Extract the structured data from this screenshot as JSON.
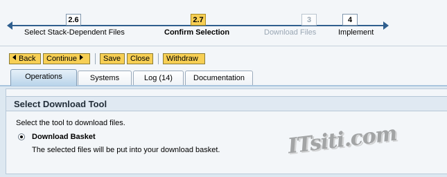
{
  "roadmap": {
    "steps": [
      {
        "number": "2.6",
        "label": "Select Stack-Dependent Files",
        "state": "done"
      },
      {
        "number": "2.7",
        "label": "Confirm Selection",
        "state": "active"
      },
      {
        "number": "3",
        "label": "Download Files",
        "state": "disabled"
      },
      {
        "number": "4",
        "label": "Implement",
        "state": "pending"
      }
    ]
  },
  "toolbar": {
    "back_label": "Back",
    "continue_label": "Continue",
    "save_label": "Save",
    "close_label": "Close",
    "withdraw_label": "Withdraw"
  },
  "tabs": [
    {
      "label": "Operations",
      "active": true
    },
    {
      "label": "Systems",
      "active": false
    },
    {
      "label": "Log (14)",
      "active": false
    },
    {
      "label": "Documentation",
      "active": false
    }
  ],
  "section": {
    "title": "Select Download Tool",
    "instruction": "Select the tool to download files.",
    "option_label": "Download Basket",
    "option_selected": true,
    "option_description": "The selected files will be put into your download basket."
  },
  "watermark": "ITsiti.com",
  "colors": {
    "accent": "#f7cf54",
    "roadmap_line": "#2f5f8f",
    "tab_active": "#b9d4ea",
    "content_bg": "#dde8f1"
  }
}
